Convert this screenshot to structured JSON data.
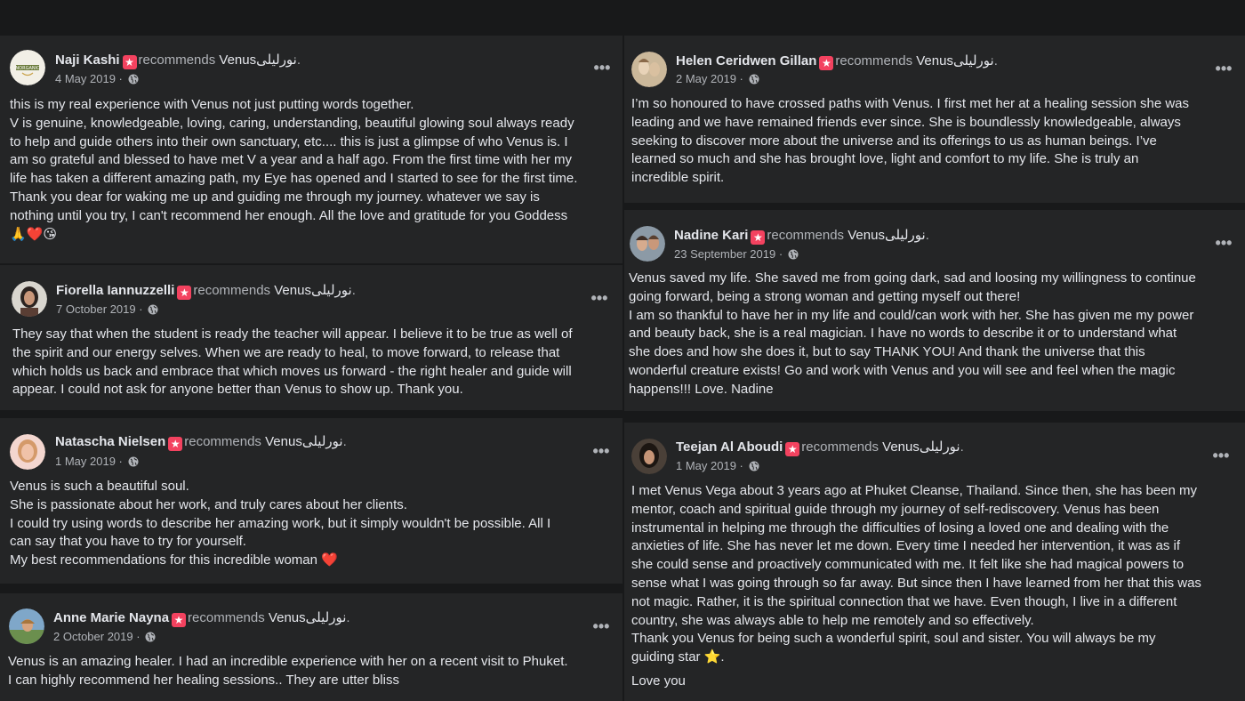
{
  "page_name": "Venusنورليلى",
  "recommends_label": "recommends",
  "more_options_glyph": "•••",
  "colors": {
    "background": "#18191a",
    "card": "#242526",
    "text": "#e4e6eb",
    "secondary": "#b0b3b8",
    "badge": "#f3425f"
  },
  "reviews": [
    {
      "name": "Naji Kashi",
      "date": "4 May 2019",
      "audience_icon": "globe-icon",
      "lines": [
        "this is my real experience with Venus not just putting words together.",
        "V is genuine, knowledgeable, loving, caring, understanding, beautiful glowing soul always ready",
        "to help and guide others into their own sanctuary, etc.... this is just a glimpse of who Venus is. I",
        "am so grateful and blessed to have met V a year and a half ago. From the first time with her my",
        "life has taken a different amazing path, my Eye has opened and I started to see for the first time.",
        "Thank you dear for waking me up and guiding me through my journey. whatever we say is",
        "nothing until you try,  I can't recommend her enough. All the love and gratitude for you Goddess",
        "🙏❤️😘"
      ]
    },
    {
      "name": "Fiorella Iannuzzelli",
      "date": "7 October 2019",
      "audience_icon": "globe-icon",
      "lines": [
        "They say that when the student is ready the teacher will appear. I believe it to be true as well of",
        "the spirit and our energy selves. When we are ready to heal, to move forward, to release that",
        "which holds us back and embrace that which moves us forward - the right healer and guide will",
        "appear. I could not ask for anyone better than Venus to show up. Thank you."
      ]
    },
    {
      "name": "Natascha Nielsen",
      "date": "1 May 2019",
      "audience_icon": "globe-icon",
      "lines": [
        "Venus is such a beautiful soul.",
        "She is passionate about her work, and truly cares about her clients.",
        "I could try using words to describe her amazing work, but it simply wouldn't be possible. All I",
        "can say that you have to try for yourself.",
        "My best recommendations for this incredible woman ❤️"
      ]
    },
    {
      "name": "Anne Marie Nayna",
      "date": "2 October 2019",
      "audience_icon": "globe-icon",
      "lines": [
        "Venus is an amazing healer.  I had an incredible experience with her on a recent visit to Phuket.",
        "I can highly recommend her healing sessions..  They are utter bliss"
      ]
    },
    {
      "name": "Helen Ceridwen Gillan",
      "date": "2 May 2019",
      "audience_icon": "globe-icon",
      "lines": [
        "I’m so honoured to have crossed paths with Venus. I first met her at a healing session she was",
        "leading and we have remained friends ever since. She is boundlessly knowledgeable, always",
        "seeking to discover more about the universe and its offerings to us as human beings. I’ve",
        "learned so much and she has brought love, light and comfort to my life. She is truly an",
        "incredible spirit."
      ]
    },
    {
      "name": "Nadine Kari",
      "date": "23 September 2019",
      "audience_icon": "globe-icon",
      "lines": [
        "Venus saved my life. She saved me from going dark, sad and loosing my willingness to continue",
        "going forward, being a strong woman and getting myself out there!",
        "I am so thankful to have her in my life and could/can work with her. She has given me my power",
        "and beauty back, she is a real magician. I have no words to describe it or to understand what",
        "she does and how she does it, but to say THANK YOU! And thank the universe that this",
        "wonderful creature exists! Go and work with Venus and you will see and feel when the magic",
        "happens!!! Love. Nadine"
      ]
    },
    {
      "name": "Teejan Al Aboudi",
      "date": "1 May 2019",
      "audience_icon": "globe-icon",
      "lines": [
        "I met Venus Vega about 3 years ago at Phuket Cleanse, Thailand. Since then, she has been my",
        "mentor, coach and spiritual guide through my journey of self-rediscovery. Venus has been",
        "instrumental in helping me through the difficulties of losing a loved one and dealing with the",
        "anxieties of life. She has never let me down. Every time I needed her intervention, it was as if",
        "she could sense and proactively communicated with me. It felt like she had magical powers to",
        "sense what I was going through so far away. But since then I have learned from her that this was",
        "not magic. Rather, it is the spiritual connection that we have. Even though, I live in a different",
        "country, she was always able to help me remotely and so effectively.",
        "Thank you Venus for being such a wonderful spirit, soul and sister. You will always be my",
        "guiding star ⭐.",
        "",
        "Love you"
      ]
    }
  ]
}
